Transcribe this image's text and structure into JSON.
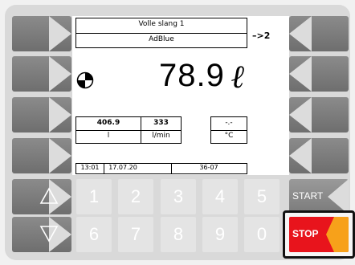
{
  "screen": {
    "header_line1": "Volle slang 1",
    "header_line2": "AdBlue",
    "arrow_indicator": "–>2",
    "main_value": "78.9",
    "main_unit": "ℓ",
    "table": {
      "values": [
        "406.9",
        "333",
        "-.-"
      ],
      "units": [
        "l",
        "l/min",
        "°C"
      ]
    },
    "status": {
      "time": "13:01",
      "date": "17.07.20",
      "empty": "",
      "code": "36-07"
    }
  },
  "keypad": {
    "row1": [
      "1",
      "2",
      "3",
      "4",
      "5"
    ],
    "row2": [
      "6",
      "7",
      "8",
      "9",
      "0"
    ]
  },
  "buttons": {
    "start_label": "START",
    "stop_label": "STOP"
  },
  "colors": {
    "stop_red": "#e8141c",
    "stop_orange": "#f7a11a"
  }
}
